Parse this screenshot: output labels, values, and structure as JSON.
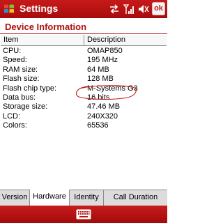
{
  "window": {
    "title": "Settings",
    "ok_label": "ok",
    "status_icons": [
      "sync-icon",
      "signal-icon",
      "speaker-icon"
    ]
  },
  "section": {
    "title": "Device Information"
  },
  "table": {
    "columns": [
      "Item",
      "Description"
    ],
    "rows": [
      {
        "item": "CPU:",
        "desc": "OMAP850"
      },
      {
        "item": "Speed:",
        "desc": "195 MHz"
      },
      {
        "item": "RAM size:",
        "desc": "64 MB"
      },
      {
        "item": "Flash size:",
        "desc": "128 MB"
      },
      {
        "item": "Flash chip type:",
        "desc": "M-Systems G3"
      },
      {
        "item": "Data bus:",
        "desc": "16 bits"
      },
      {
        "item": "Storage size:",
        "desc": "47.46 MB"
      },
      {
        "item": "LCD:",
        "desc": "240X320"
      },
      {
        "item": "Colors:",
        "desc": "65536"
      }
    ]
  },
  "tabs": [
    {
      "label": "Version"
    },
    {
      "label": "Hardware"
    },
    {
      "label": "Identity"
    },
    {
      "label": "Call Duration"
    }
  ],
  "active_tab": "Hardware",
  "colors": {
    "titlebar": "#b81414",
    "heading": "#b01010",
    "annotation": "#c41818"
  }
}
